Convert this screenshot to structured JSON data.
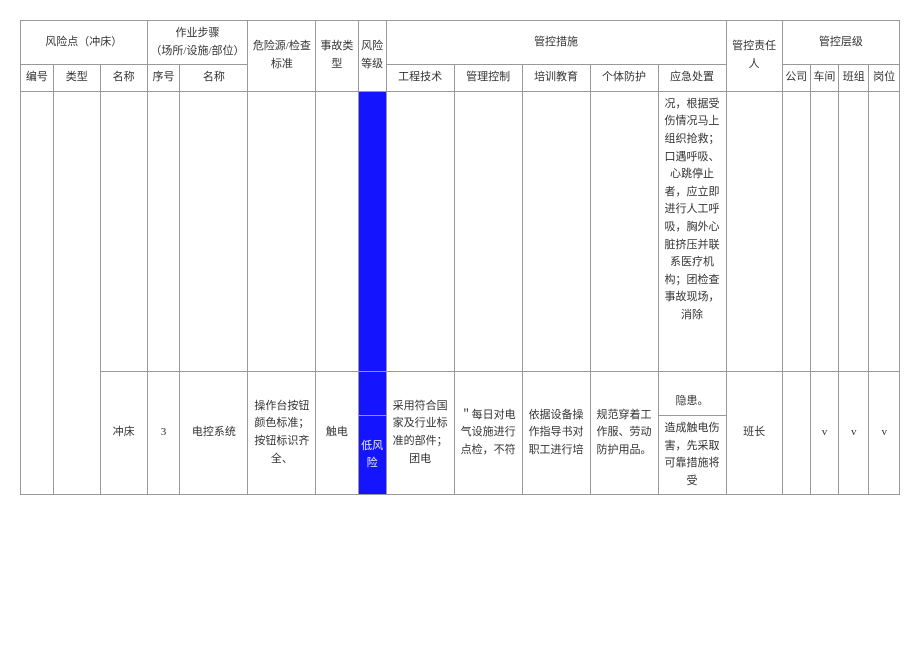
{
  "headers": {
    "risk_point": "风险点（冲床）",
    "work_step": "作业步骤\n（场所/设施/部位）",
    "hazard_std": "危险源/检查标准",
    "accident_type": "事故类型",
    "risk_level": "风险等级",
    "control_measures": "管控措施",
    "responsible": "管控责任人",
    "control_level": "管控层级",
    "bh": "编号",
    "lx": "类型",
    "mc": "名称",
    "xh": "序号",
    "bm": "名称",
    "gcjs": "工程技术",
    "glkz": "管理控制",
    "pxjy": "培训教育",
    "gtfh": "个体防护",
    "yjcz": "应急处置",
    "gs": "公司",
    "cj": "车间",
    "bz": "班组",
    "gw": "岗位"
  },
  "rows": [
    {
      "bh": "",
      "lx": "",
      "mc": "",
      "xh": "",
      "bm": "",
      "wxy": "",
      "sg": "",
      "fxdj": "",
      "gcjs": "",
      "glkz": "",
      "pxjy": "",
      "gtfh": "",
      "yjcz": "况，根据受伤情况马上组织抢救；口遇呼吸、心跳停止者，应立即进行人工呼吸，胸外心脏挤压并联系医疗机构；团检查事故现场，消除",
      "yjcz_tail": "隐患。",
      "zrr": "",
      "gs": "",
      "cj": "",
      "bz": "",
      "gw": ""
    },
    {
      "bh": "",
      "lx": "",
      "mc": "冲床",
      "xh": "3",
      "bm": "电控系统",
      "wxy": "操作台按钮颜色标准；按钮标识齐全、",
      "sg": "触电",
      "fxdj": "低风险",
      "gcjs": "采用符合国家及行业标准的部件；团电",
      "glkz": "＂每日对电气设施进行点检，不符",
      "pxjy": "依据设备操作指导书对职工进行培",
      "gtfh": "规范穿着工作服、劳动防护用品。",
      "yjcz": "造成触电伤害，先采取可靠措施将受",
      "zrr": "班长",
      "gs": "",
      "cj": "v",
      "bz": "v",
      "gw": "v"
    }
  ]
}
